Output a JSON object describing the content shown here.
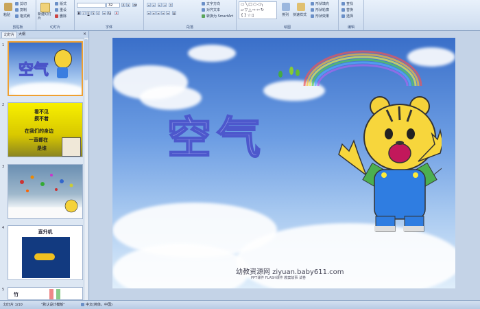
{
  "ribbon": {
    "clipboard": {
      "paste": "粘贴",
      "cut": "剪切",
      "copy": "复制",
      "format_painter": "格式刷",
      "label": "剪贴板"
    },
    "slides": {
      "new_slide": "新建幻灯片",
      "layout": "版式",
      "reset": "重设",
      "delete": "删除",
      "label": "幻灯片"
    },
    "font": {
      "size": "32",
      "label": "字体"
    },
    "paragraph": {
      "text_direction": "文字方向",
      "align_text": "对齐文本",
      "smartart": "转换为 SmartArt",
      "label": "段落"
    },
    "drawing": {
      "arrange": "排列",
      "quick_styles": "快速样式",
      "shape_fill": "形状填充",
      "shape_outline": "形状轮廓",
      "shape_effects": "形状效果",
      "label": "绘图"
    },
    "editing": {
      "find": "查找",
      "replace": "替换",
      "select": "选择",
      "label": "编辑"
    }
  },
  "panel": {
    "tabs": [
      "幻灯片",
      "大纲"
    ],
    "thumbs": [
      {
        "num": "1",
        "title": "空气"
      },
      {
        "num": "2",
        "lines": [
          "看不见",
          "摸不着",
          "在我们的身边",
          "一直都在",
          "是谁"
        ]
      },
      {
        "num": "3"
      },
      {
        "num": "4",
        "title": "直升机"
      },
      {
        "num": "5",
        "title": "竹"
      }
    ]
  },
  "slide": {
    "title": "空气",
    "watermark": "幼教资源网 ziyuan.baby611.com",
    "watermark_sub": "PPT课件  FLASH课件  教案故事  试卷"
  },
  "status": {
    "slide_info": "幻灯片 1/10",
    "theme": "\"默认设计模板\"",
    "language": "中文(简体，中国)"
  },
  "colors": {
    "accent": "#6a8fc7",
    "title_fill": "#6b74d8",
    "sky_top": "#3a6fc9"
  }
}
